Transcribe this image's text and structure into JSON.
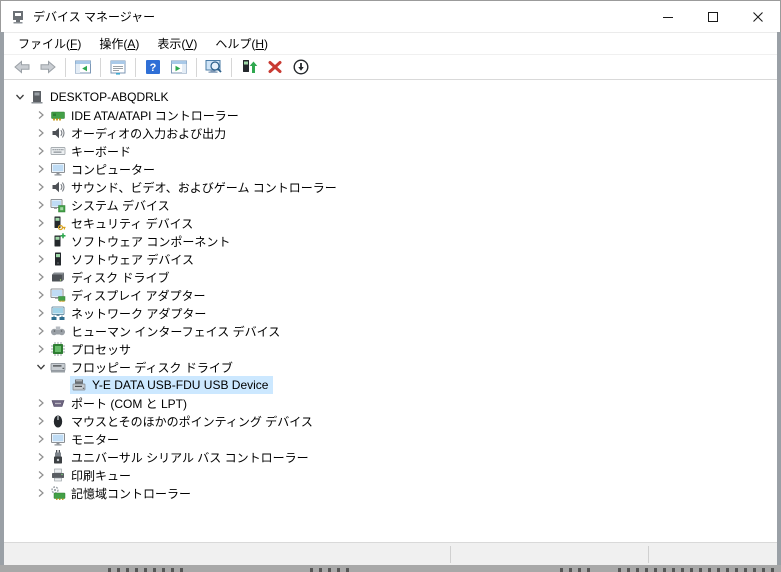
{
  "window": {
    "title": "デバイス マネージャー",
    "controls": {
      "minimize": "minimize",
      "maximize": "maximize",
      "close": "close"
    }
  },
  "menu": {
    "items": [
      {
        "id": "file",
        "label": "ファイル(F)"
      },
      {
        "id": "action",
        "label": "操作(A)"
      },
      {
        "id": "view",
        "label": "表示(V)"
      },
      {
        "id": "help",
        "label": "ヘルプ(H)"
      }
    ]
  },
  "toolbar": {
    "items": [
      {
        "type": "button",
        "name": "back",
        "icon": "arrow-left"
      },
      {
        "type": "button",
        "name": "forward",
        "icon": "arrow-right"
      },
      {
        "type": "separator"
      },
      {
        "type": "button",
        "name": "show-console-tree",
        "icon": "console-tree"
      },
      {
        "type": "separator"
      },
      {
        "type": "button",
        "name": "properties",
        "icon": "properties-window"
      },
      {
        "type": "separator"
      },
      {
        "type": "button",
        "name": "help",
        "icon": "help-question"
      },
      {
        "type": "button",
        "name": "action-pane",
        "icon": "action-pane"
      },
      {
        "type": "separator"
      },
      {
        "type": "button",
        "name": "scan-hardware-changes",
        "icon": "scan-monitor-magnifier"
      },
      {
        "type": "separator"
      },
      {
        "type": "button",
        "name": "update-driver",
        "icon": "device-up-arrow"
      },
      {
        "type": "button",
        "name": "uninstall-device",
        "icon": "red-x"
      },
      {
        "type": "button",
        "name": "disable-device",
        "icon": "circle-down-arrow"
      }
    ]
  },
  "tree": {
    "items": [
      {
        "id": "desktop-abqdrlk",
        "label": "DESKTOP-ABQDRLK",
        "icon": "computer",
        "level": 0,
        "chevron": "expanded",
        "selected": false
      },
      {
        "id": "ide-ata-atapi",
        "label": "IDE ATA/ATAPI コントローラー",
        "icon": "ide",
        "level": 1,
        "chevron": "collapsed",
        "selected": false
      },
      {
        "id": "audio-inputs-outputs",
        "label": "オーディオの入力および出力",
        "icon": "audio",
        "level": 1,
        "chevron": "collapsed",
        "selected": false
      },
      {
        "id": "keyboards",
        "label": "キーボード",
        "icon": "keyboard",
        "level": 1,
        "chevron": "collapsed",
        "selected": false
      },
      {
        "id": "computer",
        "label": "コンピューター",
        "icon": "monitor",
        "level": 1,
        "chevron": "collapsed",
        "selected": false
      },
      {
        "id": "sound-video-game",
        "label": "サウンド、ビデオ、およびゲーム コントローラー",
        "icon": "audio",
        "level": 1,
        "chevron": "collapsed",
        "selected": false
      },
      {
        "id": "system-devices",
        "label": "システム デバイス",
        "icon": "system",
        "level": 1,
        "chevron": "collapsed",
        "selected": false
      },
      {
        "id": "security-devices",
        "label": "セキュリティ デバイス",
        "icon": "security",
        "level": 1,
        "chevron": "collapsed",
        "selected": false
      },
      {
        "id": "software-components",
        "label": "ソフトウェア コンポーネント",
        "icon": "sw-component",
        "level": 1,
        "chevron": "collapsed",
        "selected": false
      },
      {
        "id": "software-devices",
        "label": "ソフトウェア デバイス",
        "icon": "sw-device",
        "level": 1,
        "chevron": "collapsed",
        "selected": false
      },
      {
        "id": "disk-drives",
        "label": "ディスク ドライブ",
        "icon": "disk",
        "level": 1,
        "chevron": "collapsed",
        "selected": false
      },
      {
        "id": "display-adapters",
        "label": "ディスプレイ アダプター",
        "icon": "display",
        "level": 1,
        "chevron": "collapsed",
        "selected": false
      },
      {
        "id": "network-adapters",
        "label": "ネットワーク アダプター",
        "icon": "network",
        "level": 1,
        "chevron": "collapsed",
        "selected": false
      },
      {
        "id": "hid-devices",
        "label": "ヒューマン インターフェイス デバイス",
        "icon": "hid",
        "level": 1,
        "chevron": "collapsed",
        "selected": false
      },
      {
        "id": "processors",
        "label": "プロセッサ",
        "icon": "cpu",
        "level": 1,
        "chevron": "collapsed",
        "selected": false
      },
      {
        "id": "floppy-disk-drives",
        "label": "フロッピー ディスク ドライブ",
        "icon": "floppy-drive",
        "level": 1,
        "chevron": "expanded",
        "selected": false
      },
      {
        "id": "ye-data-usb-fdu",
        "label": "Y-E DATA USB-FDU USB Device",
        "icon": "floppy-device",
        "level": 2,
        "chevron": "none",
        "selected": true
      },
      {
        "id": "ports-com-lpt",
        "label": "ポート (COM と LPT)",
        "icon": "port",
        "level": 1,
        "chevron": "collapsed",
        "selected": false
      },
      {
        "id": "mice-pointing",
        "label": "マウスとそのほかのポインティング デバイス",
        "icon": "mouse",
        "level": 1,
        "chevron": "collapsed",
        "selected": false
      },
      {
        "id": "monitors",
        "label": "モニター",
        "icon": "monitor",
        "level": 1,
        "chevron": "collapsed",
        "selected": false
      },
      {
        "id": "usb-controllers",
        "label": "ユニバーサル シリアル バス コントローラー",
        "icon": "usb",
        "level": 1,
        "chevron": "collapsed",
        "selected": false
      },
      {
        "id": "print-queues",
        "label": "印刷キュー",
        "icon": "printer",
        "level": 1,
        "chevron": "collapsed",
        "selected": false
      },
      {
        "id": "storage-controllers",
        "label": "記憶域コントローラー",
        "icon": "storage",
        "level": 1,
        "chevron": "collapsed",
        "selected": false
      }
    ]
  },
  "statusbar": {
    "sections": [
      "",
      "",
      ""
    ]
  },
  "colors": {
    "selection_bg": "#cce8ff",
    "window_frame": "#9aa0a6",
    "statusbar_bg": "#f0f0f0",
    "help_blue": "#2f6fd6",
    "uninstall_red": "#c93a32",
    "action_green": "#2fa84f"
  }
}
